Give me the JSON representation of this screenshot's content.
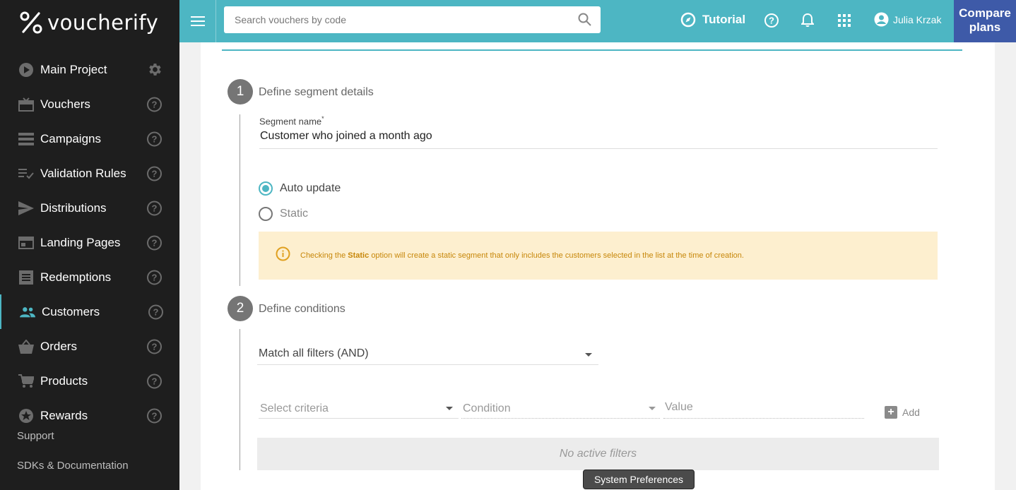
{
  "logo": {
    "text": "voucherify"
  },
  "sidebar": {
    "items": [
      {
        "label": "Main Project",
        "icon": "play-circle-icon"
      },
      {
        "label": "Vouchers",
        "icon": "gift-icon"
      },
      {
        "label": "Campaigns",
        "icon": "list-icon"
      },
      {
        "label": "Validation Rules",
        "icon": "checklist-icon"
      },
      {
        "label": "Distributions",
        "icon": "send-icon"
      },
      {
        "label": "Landing Pages",
        "icon": "web-icon"
      },
      {
        "label": "Redemptions",
        "icon": "receipt-icon"
      },
      {
        "label": "Customers",
        "icon": "people-icon",
        "active": true
      },
      {
        "label": "Orders",
        "icon": "basket-icon"
      },
      {
        "label": "Products",
        "icon": "cart-icon"
      },
      {
        "label": "Rewards",
        "icon": "star-icon"
      }
    ],
    "support": "Support",
    "sdks": "SDKs & Documentation",
    "help_glyph": "?"
  },
  "topbar": {
    "search_placeholder": "Search vouchers by code",
    "tutorial": "Tutorial",
    "user": "Julia Krzak",
    "compare_line1": "Compare",
    "compare_line2": "plans"
  },
  "form": {
    "step1": {
      "number": "1",
      "title": "Define segment details"
    },
    "segment_label": "Segment name",
    "required_mark": "*",
    "segment_value": "Customer who joined a month ago",
    "radio_auto": "Auto update",
    "radio_static": "Static",
    "info_prefix": "Checking the",
    "info_bold": "Static",
    "info_suffix": "option will create a static segment that only includes the customers selected in the list at the time of creation.",
    "step2": {
      "number": "2",
      "title": "Define conditions"
    },
    "match_value": "Match all filters (AND)",
    "criteria_placeholder": "Select criteria",
    "condition_placeholder": "Condition",
    "value_placeholder": "Value",
    "add_label": "Add",
    "no_filters": "No active filters"
  },
  "tooltip": "System Preferences",
  "colors": {
    "accent": "#4db6c3",
    "sidebar": "#1e1e1e",
    "compare": "#3e5aa8",
    "info_bg": "#fdefcf",
    "info_text": "#c7870a"
  }
}
